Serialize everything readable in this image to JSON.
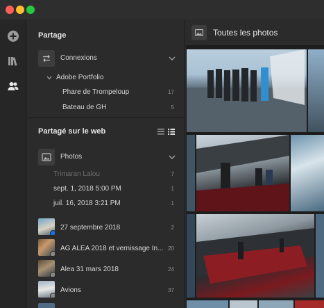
{
  "window": {
    "controls": [
      "close",
      "minimize",
      "zoom"
    ]
  },
  "rail": {
    "items": [
      {
        "icon": "add-icon",
        "state": "normal"
      },
      {
        "icon": "library-icon",
        "state": "normal"
      },
      {
        "icon": "people-icon",
        "state": "active"
      }
    ]
  },
  "sharing": {
    "title": "Partage",
    "connections_label": "Connexions",
    "portfolio_label": "Adobe Portfolio",
    "portfolio_items": [
      {
        "label": "Phare de Trompeloup",
        "count": "17"
      },
      {
        "label": "Bateau de GH",
        "count": "5"
      }
    ]
  },
  "web": {
    "title": "Partagé sur le web",
    "photos_label": "Photos",
    "albums": [
      {
        "label": "Trimaran Lalou",
        "count": "7",
        "dim": true
      },
      {
        "label": "sept. 1, 2018 5:00 PM",
        "count": "1"
      },
      {
        "label": "juil. 16, 2018 3:21 PM",
        "count": "1"
      },
      {
        "label": "27 septembre 2018",
        "count": "2",
        "badge": "shared"
      },
      {
        "label": "AG ALEA 2018 et vernissage In...",
        "count": "20",
        "badge": "check"
      },
      {
        "label": "Alea 31 mars 2018",
        "count": "24",
        "badge": "check"
      },
      {
        "label": "Avions",
        "count": "37",
        "badge": "check"
      }
    ]
  },
  "main": {
    "title": "Toutes les photos"
  },
  "colors": {
    "accent_blue": "#1473e6",
    "panel": "#2b2b2b",
    "text": "#d6d6d6",
    "muted": "#8f8f8f"
  }
}
